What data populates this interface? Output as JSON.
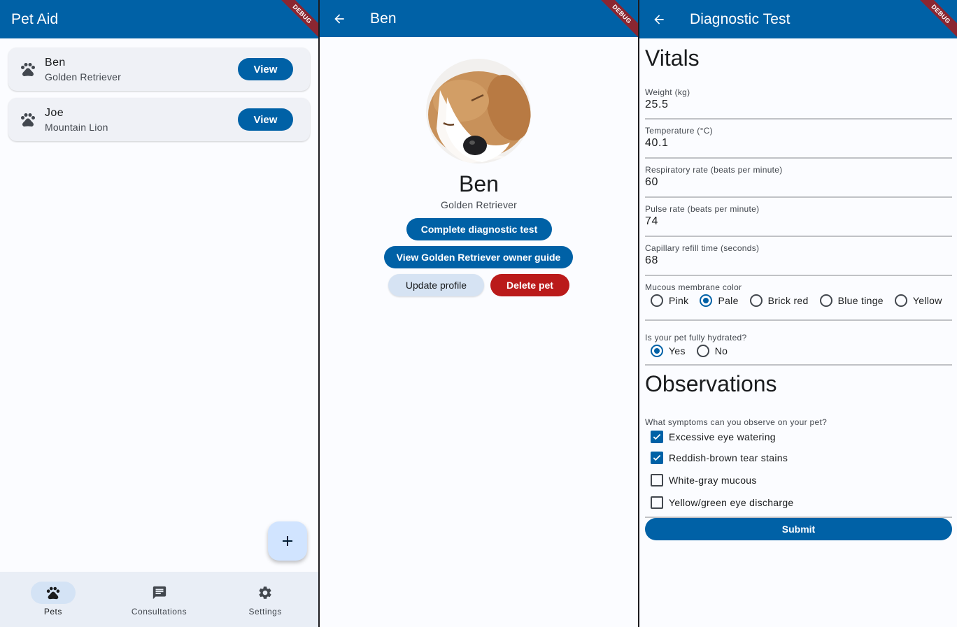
{
  "colors": {
    "primary": "#0061a6",
    "danger": "#ba1a1a",
    "tonal": "#d6e3f3",
    "fab": "#d1e4ff",
    "debug_banner": "#8b2631"
  },
  "debug_banner": "DEBUG",
  "pets_screen": {
    "title": "Pet Aid",
    "pets": [
      {
        "name": "Ben",
        "breed": "Golden Retriever",
        "action": "View",
        "icon": "paw-icon"
      },
      {
        "name": "Joe",
        "breed": "Mountain Lion",
        "action": "View",
        "icon": "paw-icon"
      }
    ],
    "fab_icon": "plus-icon",
    "nav": [
      {
        "label": "Pets",
        "icon": "paw-icon",
        "active": true
      },
      {
        "label": "Consultations",
        "icon": "chat-icon",
        "active": false
      },
      {
        "label": "Settings",
        "icon": "gear-icon",
        "active": false
      }
    ]
  },
  "pet_screen": {
    "title": "Ben",
    "name": "Ben",
    "breed": "Golden Retriever",
    "avatar": "sleeping-puppy-photo",
    "buttons": {
      "diagnostic": "Complete diagnostic test",
      "guide": "View Golden Retriever owner guide",
      "update": "Update profile",
      "delete": "Delete pet"
    }
  },
  "diagnostic_screen": {
    "title": "Diagnostic Test",
    "vitals_title": "Vitals",
    "fields": [
      {
        "label": "Weight (kg)",
        "value": "25.5"
      },
      {
        "label": "Temperature (°C)",
        "value": "40.1"
      },
      {
        "label": "Respiratory rate (beats per minute)",
        "value": "60"
      },
      {
        "label": "Pulse rate (beats per minute)",
        "value": "74"
      },
      {
        "label": "Capillary refill time (seconds)",
        "value": "68"
      }
    ],
    "mucous": {
      "label": "Mucous membrane color",
      "options": [
        "Pink",
        "Pale",
        "Brick red",
        "Blue tinge",
        "Yellow"
      ],
      "selected": "Pale"
    },
    "hydrated": {
      "label": "Is your pet fully hydrated?",
      "options": [
        "Yes",
        "No"
      ],
      "selected": "Yes"
    },
    "observations_title": "Observations",
    "symptoms": {
      "label": "What symptoms can you observe on your pet?",
      "options": [
        {
          "label": "Excessive eye watering",
          "checked": true
        },
        {
          "label": "Reddish-brown tear stains",
          "checked": true
        },
        {
          "label": "White-gray mucous",
          "checked": false
        },
        {
          "label": "Yellow/green eye discharge",
          "checked": false
        }
      ]
    },
    "submit": "Submit"
  }
}
